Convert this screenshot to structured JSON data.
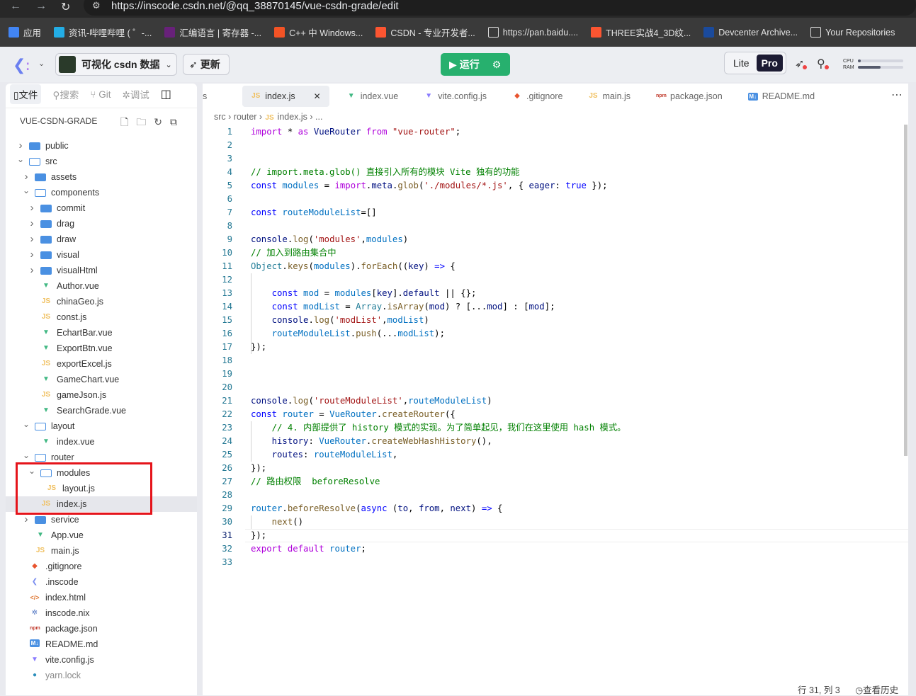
{
  "browser": {
    "url": "https://inscode.csdn.net/@qq_38870145/vue-csdn-grade/edit",
    "bookmarks": [
      {
        "label": "应用",
        "icon": "apps-grid-icon",
        "color": "#4285f4"
      },
      {
        "label": "资讯-哔哩哔哩 ( ゜-...",
        "icon": "bilibili-icon",
        "color": "#23ade5"
      },
      {
        "label": "汇编语言 | 寄存器 -...",
        "icon": "visual-studio-icon",
        "color": "#68217a"
      },
      {
        "label": "C++ 中 Windows...",
        "icon": "windows-icon",
        "color": "#f35325"
      },
      {
        "label": "CSDN - 专业开发者...",
        "icon": "csdn-icon",
        "color": "#fc5531"
      },
      {
        "label": "https://pan.baidu....",
        "icon": "baidu-pan-icon",
        "color": "#ffffff"
      },
      {
        "label": "THREE实战4_3D纹...",
        "icon": "csdn-icon",
        "color": "#fc5531"
      },
      {
        "label": "Devcenter Archive...",
        "icon": "w-icon",
        "color": "#1a4a9c"
      },
      {
        "label": "Your Repositories",
        "icon": "github-icon",
        "color": "#ffffff"
      }
    ]
  },
  "header": {
    "project": "可视化 csdn 数据",
    "update": "更新",
    "run": "运行",
    "lite": "Lite",
    "pro": "Pro",
    "cpu": "CPU",
    "ram": "RAM",
    "cpu_usage": 0.07,
    "ram_usage": 0.5
  },
  "sidebar": {
    "tabs": [
      "文件",
      "搜索",
      "Git",
      "调试"
    ],
    "project_name": "VUE-CSDN-GRADE",
    "tree": [
      {
        "n": "public",
        "d": 0,
        "t": "folder"
      },
      {
        "n": "src",
        "d": 0,
        "t": "folder-open"
      },
      {
        "n": "assets",
        "d": 1,
        "t": "folder"
      },
      {
        "n": "components",
        "d": 1,
        "t": "folder-open"
      },
      {
        "n": "commit",
        "d": 2,
        "t": "folder"
      },
      {
        "n": "drag",
        "d": 2,
        "t": "folder"
      },
      {
        "n": "draw",
        "d": 2,
        "t": "folder"
      },
      {
        "n": "visual",
        "d": 2,
        "t": "folder"
      },
      {
        "n": "visualHtml",
        "d": 2,
        "t": "folder"
      },
      {
        "n": "Author.vue",
        "d": 2,
        "t": "vue"
      },
      {
        "n": "chinaGeo.js",
        "d": 2,
        "t": "js"
      },
      {
        "n": "const.js",
        "d": 2,
        "t": "js"
      },
      {
        "n": "EchartBar.vue",
        "d": 2,
        "t": "vue"
      },
      {
        "n": "ExportBtn.vue",
        "d": 2,
        "t": "vue"
      },
      {
        "n": "exportExcel.js",
        "d": 2,
        "t": "js"
      },
      {
        "n": "GameChart.vue",
        "d": 2,
        "t": "vue"
      },
      {
        "n": "gameJson.js",
        "d": 2,
        "t": "js"
      },
      {
        "n": "SearchGrade.vue",
        "d": 2,
        "t": "vue"
      },
      {
        "n": "layout",
        "d": 1,
        "t": "folder-open"
      },
      {
        "n": "index.vue",
        "d": 2,
        "t": "vue"
      },
      {
        "n": "router",
        "d": 1,
        "t": "folder-open"
      },
      {
        "n": "modules",
        "d": 2,
        "t": "folder-open"
      },
      {
        "n": "layout.js",
        "d": 3,
        "t": "js"
      },
      {
        "n": "index.js",
        "d": 2,
        "t": "js",
        "selected": true
      },
      {
        "n": "service",
        "d": 1,
        "t": "folder"
      },
      {
        "n": "App.vue",
        "d": 1,
        "t": "vue"
      },
      {
        "n": "main.js",
        "d": 1,
        "t": "js"
      },
      {
        "n": ".gitignore",
        "d": 0,
        "t": "git"
      },
      {
        "n": ".inscode",
        "d": 0,
        "t": "inscode"
      },
      {
        "n": "index.html",
        "d": 0,
        "t": "html"
      },
      {
        "n": "inscode.nix",
        "d": 0,
        "t": "nix"
      },
      {
        "n": "package.json",
        "d": 0,
        "t": "npm"
      },
      {
        "n": "README.md",
        "d": 0,
        "t": "md"
      },
      {
        "n": "vite.config.js",
        "d": 0,
        "t": "vite"
      },
      {
        "n": "yarn.lock",
        "d": 0,
        "t": "yarn"
      }
    ]
  },
  "editor": {
    "tabs": [
      {
        "label": "s",
        "t": "none"
      },
      {
        "label": "index.js",
        "t": "js",
        "active": true
      },
      {
        "label": "index.vue",
        "t": "vue"
      },
      {
        "label": "vite.config.js",
        "t": "vite"
      },
      {
        "label": ".gitignore",
        "t": "git"
      },
      {
        "label": "main.js",
        "t": "js"
      },
      {
        "label": "package.json",
        "t": "npm"
      },
      {
        "label": "README.md",
        "t": "md"
      }
    ],
    "breadcrumb": [
      "src",
      "router",
      "index.js",
      "..."
    ],
    "cursor_line": 31,
    "lines": [
      [
        [
          "p",
          "import"
        ],
        [
          "o",
          " * "
        ],
        [
          "p",
          "as"
        ],
        [
          "v",
          " VueRouter "
        ],
        [
          "p",
          "from"
        ],
        [
          "s",
          " \"vue-router\""
        ],
        [
          "o",
          ";"
        ]
      ],
      [],
      [],
      [
        [
          "c",
          "// import.meta.glob() 直接引入所有的模块 Vite 独有的功能"
        ]
      ],
      [
        [
          "k",
          "const"
        ],
        [
          "m",
          " modules"
        ],
        [
          "o",
          " = "
        ],
        [
          "p",
          "import"
        ],
        [
          "o",
          "."
        ],
        [
          "v",
          "meta"
        ],
        [
          "o",
          "."
        ],
        [
          "f",
          "glob"
        ],
        [
          "o",
          "("
        ],
        [
          "s",
          "'./modules/*.js'"
        ],
        [
          "o",
          ", { "
        ],
        [
          "v",
          "eager"
        ],
        [
          "o",
          ": "
        ],
        [
          "k",
          "true"
        ],
        [
          "o",
          " });"
        ]
      ],
      [],
      [
        [
          "k",
          "const"
        ],
        [
          "m",
          " routeModuleList"
        ],
        [
          "o",
          "=[]"
        ]
      ],
      [],
      [
        [
          "v",
          "console"
        ],
        [
          "o",
          "."
        ],
        [
          "f",
          "log"
        ],
        [
          "o",
          "("
        ],
        [
          "s",
          "'modules'"
        ],
        [
          "o",
          ","
        ],
        [
          "m",
          "modules"
        ],
        [
          "o",
          ")"
        ]
      ],
      [
        [
          "c",
          "// 加入到路由集合中"
        ]
      ],
      [
        [
          "t",
          "Object"
        ],
        [
          "o",
          "."
        ],
        [
          "f",
          "keys"
        ],
        [
          "o",
          "("
        ],
        [
          "m",
          "modules"
        ],
        [
          "o",
          ")."
        ],
        [
          "f",
          "forEach"
        ],
        [
          "o",
          "(("
        ],
        [
          "v",
          "key"
        ],
        [
          "o",
          ") "
        ],
        [
          "k",
          "=>"
        ],
        [
          "o",
          " {"
        ]
      ],
      [],
      [
        [
          "o",
          "    "
        ],
        [
          "k",
          "const"
        ],
        [
          "m",
          " mod"
        ],
        [
          "o",
          " = "
        ],
        [
          "m",
          "modules"
        ],
        [
          "o",
          "["
        ],
        [
          "v",
          "key"
        ],
        [
          "o",
          "]."
        ],
        [
          "v",
          "default"
        ],
        [
          "o",
          " || {};"
        ]
      ],
      [
        [
          "o",
          "    "
        ],
        [
          "k",
          "const"
        ],
        [
          "m",
          " modList"
        ],
        [
          "o",
          " = "
        ],
        [
          "t",
          "Array"
        ],
        [
          "o",
          "."
        ],
        [
          "f",
          "isArray"
        ],
        [
          "o",
          "("
        ],
        [
          "v",
          "mod"
        ],
        [
          "o",
          ") ? [..."
        ],
        [
          "v",
          "mod"
        ],
        [
          "o",
          "] : ["
        ],
        [
          "v",
          "mod"
        ],
        [
          "o",
          "];"
        ]
      ],
      [
        [
          "o",
          "    "
        ],
        [
          "v",
          "console"
        ],
        [
          "o",
          "."
        ],
        [
          "f",
          "log"
        ],
        [
          "o",
          "("
        ],
        [
          "s",
          "'modList'"
        ],
        [
          "o",
          ","
        ],
        [
          "m",
          "modList"
        ],
        [
          "o",
          ")"
        ]
      ],
      [
        [
          "o",
          "    "
        ],
        [
          "m",
          "routeModuleList"
        ],
        [
          "o",
          "."
        ],
        [
          "f",
          "push"
        ],
        [
          "o",
          "(..."
        ],
        [
          "m",
          "modList"
        ],
        [
          "o",
          ");"
        ]
      ],
      [
        [
          "o",
          "});"
        ]
      ],
      [],
      [],
      [],
      [
        [
          "v",
          "console"
        ],
        [
          "o",
          "."
        ],
        [
          "f",
          "log"
        ],
        [
          "o",
          "("
        ],
        [
          "s",
          "'routeModuleList'"
        ],
        [
          "o",
          ","
        ],
        [
          "m",
          "routeModuleList"
        ],
        [
          "o",
          ")"
        ]
      ],
      [
        [
          "k",
          "const"
        ],
        [
          "m",
          " router"
        ],
        [
          "o",
          " = "
        ],
        [
          "m",
          "VueRouter"
        ],
        [
          "o",
          "."
        ],
        [
          "f",
          "createRouter"
        ],
        [
          "o",
          "({"
        ]
      ],
      [
        [
          "o",
          "    "
        ],
        [
          "c",
          "// 4. 内部提供了 history 模式的实现。为了简单起见，我们在这里使用 hash 模式。"
        ]
      ],
      [
        [
          "o",
          "    "
        ],
        [
          "v",
          "history"
        ],
        [
          "o",
          ": "
        ],
        [
          "m",
          "VueRouter"
        ],
        [
          "o",
          "."
        ],
        [
          "f",
          "createWebHashHistory"
        ],
        [
          "o",
          "(),"
        ]
      ],
      [
        [
          "o",
          "    "
        ],
        [
          "v",
          "routes"
        ],
        [
          "o",
          ": "
        ],
        [
          "m",
          "routeModuleList"
        ],
        [
          "o",
          ","
        ]
      ],
      [
        [
          "o",
          "});"
        ]
      ],
      [
        [
          "c",
          "// 路由权限  beforeResolve"
        ]
      ],
      [],
      [
        [
          "m",
          "router"
        ],
        [
          "o",
          "."
        ],
        [
          "f",
          "beforeResolve"
        ],
        [
          "o",
          "("
        ],
        [
          "k",
          "async"
        ],
        [
          "o",
          " ("
        ],
        [
          "v",
          "to"
        ],
        [
          "o",
          ", "
        ],
        [
          "v",
          "from"
        ],
        [
          "o",
          ", "
        ],
        [
          "v",
          "next"
        ],
        [
          "o",
          ") "
        ],
        [
          "k",
          "=>"
        ],
        [
          "o",
          " {"
        ]
      ],
      [
        [
          "o",
          "    "
        ],
        [
          "f",
          "next"
        ],
        [
          "o",
          "()"
        ]
      ],
      [
        [
          "o",
          "});"
        ]
      ],
      [
        [
          "p",
          "export"
        ],
        [
          "p",
          " default"
        ],
        [
          "m",
          " router"
        ],
        [
          "o",
          ";"
        ]
      ],
      []
    ]
  },
  "status": {
    "position": "行 31, 列 3",
    "history": "查看历史"
  }
}
